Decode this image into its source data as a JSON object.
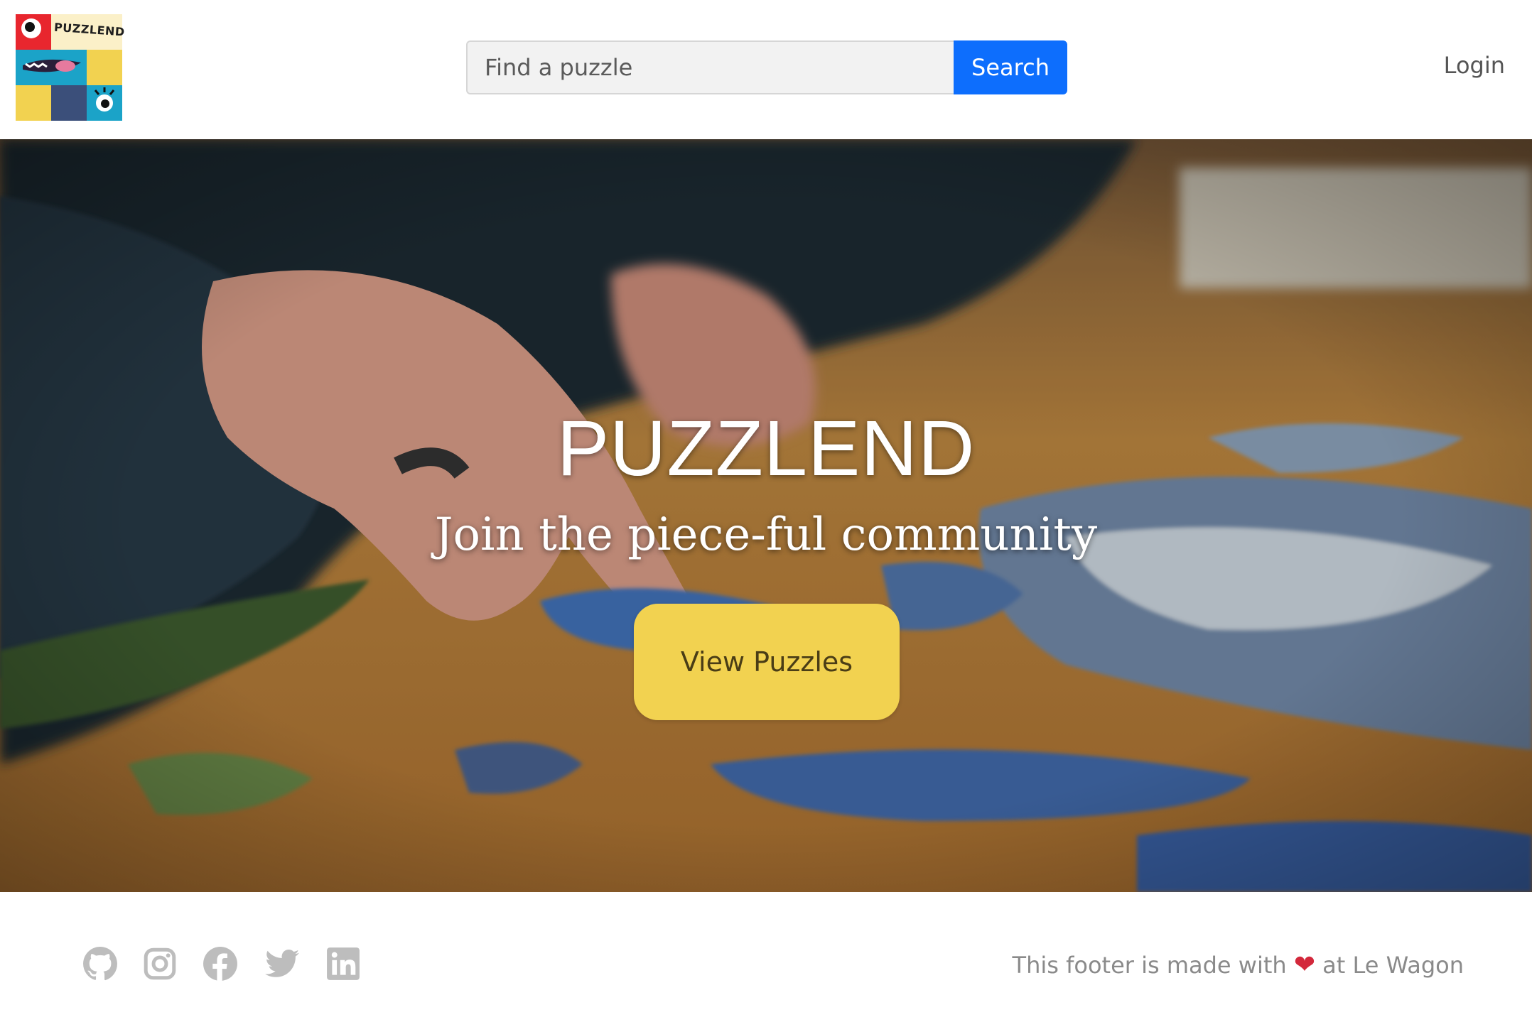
{
  "brand": {
    "logo_text": "PUZZLEND"
  },
  "search": {
    "placeholder": "Find a puzzle",
    "button_label": "Search"
  },
  "nav": {
    "login_label": "Login"
  },
  "hero": {
    "title": "PUZZLEND",
    "subtitle": "Join the piece-ful community",
    "cta_label": "View Puzzles"
  },
  "footer": {
    "social_icons": [
      "github-icon",
      "instagram-icon",
      "facebook-icon",
      "twitter-icon",
      "linkedin-icon"
    ],
    "note_before": "This footer is made with",
    "note_heart": "❤",
    "note_after": "at Le Wagon"
  },
  "colors": {
    "primary_button": "#0d6efd",
    "cta_button": "#f2d250",
    "footer_icon": "#bdbdbd",
    "heart": "#d3283b"
  }
}
